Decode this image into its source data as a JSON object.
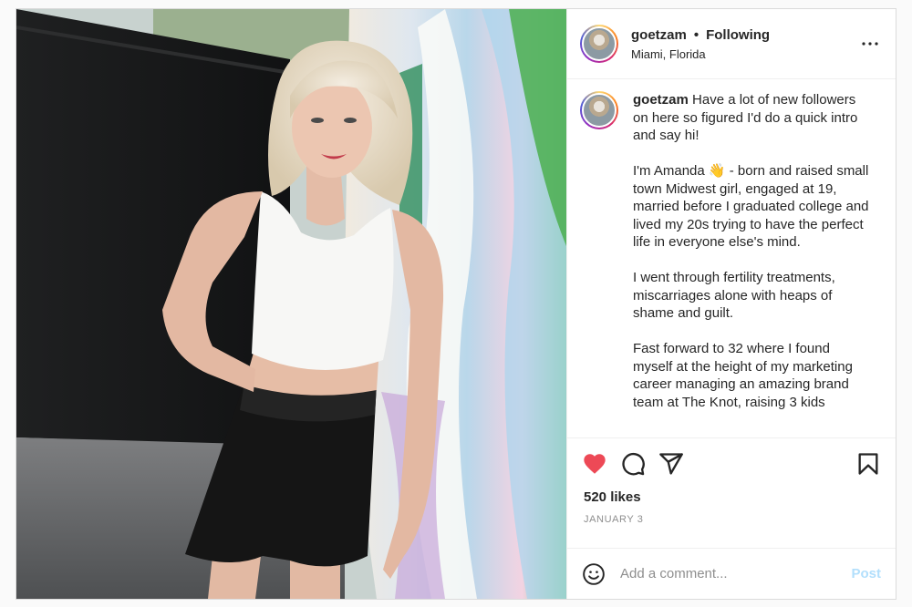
{
  "post": {
    "username": "goetzam",
    "follow_status": "Following",
    "separator": "•",
    "location": "Miami, Florida",
    "more_icon": "more-horizontal-icon",
    "caption": {
      "username": "goetzam",
      "first": "Have a lot of new followers on here so figured I'd do a quick intro and say hi!",
      "para2": "I'm Amanda 👋 - born and raised small town Midwest girl, engaged at 19, married before I graduated college and lived my 20s trying to have the perfect life in everyone else's mind.",
      "para3": "I went through fertility treatments, miscarriages alone with heaps of shame and guilt.",
      "para4": "Fast forward to 32 where I found myself at the height of my marketing career managing an amazing brand team at The Knot, raising 3 kids"
    },
    "actions": {
      "like_icon": "heart-filled-icon",
      "comment_icon": "comment-icon",
      "share_icon": "share-icon",
      "save_icon": "bookmark-icon",
      "like_color": "#ed4956"
    },
    "likes": "520 likes",
    "date": "JANUARY 3",
    "comment": {
      "placeholder": "Add a comment...",
      "emoji_icon": "smiley-icon",
      "post_label": "Post",
      "post_color": "#b2dffc"
    }
  }
}
